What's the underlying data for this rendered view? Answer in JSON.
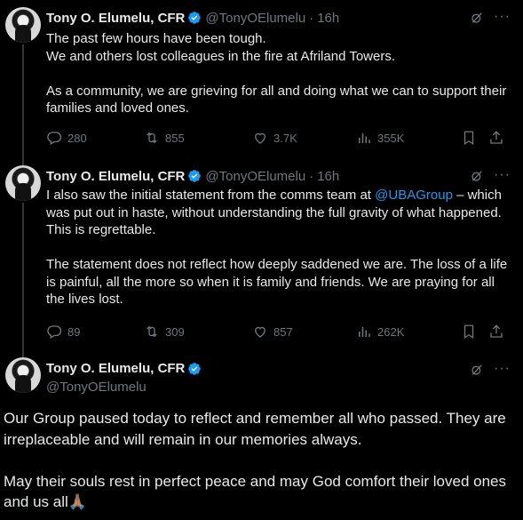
{
  "tweets": [
    {
      "name": "Tony O. Elumelu, CFR",
      "handle": "@TonyOElumelu",
      "sep": "·",
      "time": "16h",
      "paragraphs": [
        "The past few hours have been tough.\nWe and others lost colleagues in the fire at Afriland Towers.",
        "As a community, we are grieving for all and doing what we can to support their families and loved ones."
      ],
      "replies": "280",
      "reposts": "855",
      "likes": "3.7K",
      "views": "355K"
    },
    {
      "name": "Tony O. Elumelu, CFR",
      "handle": "@TonyOElumelu",
      "sep": "·",
      "time": "16h",
      "p1_before": "I also saw the initial statement from the comms team at ",
      "p1_mention": "@UBAGroup",
      "p1_after": " – which was put out in haste, without understanding the full gravity of what happened. This is  regrettable.",
      "p2": "The statement does not reflect how deeply saddened we are. The loss of a life is painful, all the more so when it is family and friends. We are praying for all the lives lost.",
      "replies": "89",
      "reposts": "309",
      "likes": "857",
      "views": "262K"
    },
    {
      "name": "Tony O. Elumelu, CFR",
      "handle": "@TonyOElumelu",
      "p1": "Our Group paused today to reflect and remember all who passed. They are irreplaceable and will remain in our memories always.",
      "p2": "May their souls rest in perfect peace and may God comfort their loved ones and us all",
      "emoji": "🙏🏽"
    }
  ],
  "icons": {
    "more": "more-icon",
    "grok": "grok-icon",
    "verified": "verified-badge-icon",
    "reply": "reply-icon",
    "repost": "repost-icon",
    "like": "like-icon",
    "views": "views-icon",
    "bookmark": "bookmark-icon",
    "share": "share-icon"
  },
  "colors": {
    "background": "#000000",
    "text": "#e7e9ea",
    "muted": "#71767b",
    "accent": "#1d9bf0",
    "thread_line": "#333639"
  }
}
